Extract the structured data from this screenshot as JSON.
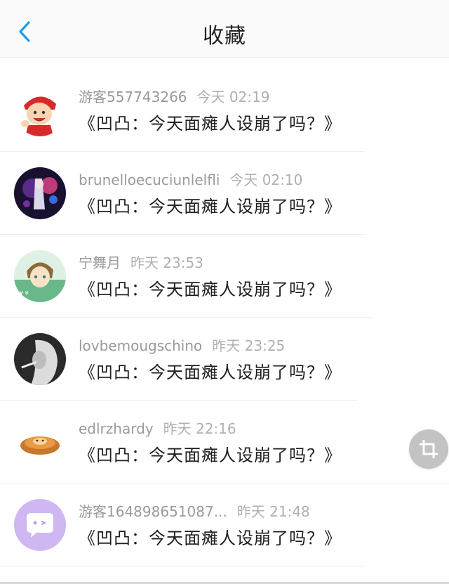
{
  "header": {
    "title": "收藏",
    "back_icon": "chevron-left-icon",
    "accent": "#1a9bf0"
  },
  "items": [
    {
      "user": "游客557743266",
      "time": "今天 02:19",
      "content": "《凹凸：今天面瘫人设崩了吗？》",
      "avatar": "cartoon-boy-avatar"
    },
    {
      "user": "brunelloecuciunlelfli",
      "time": "今天 02:10",
      "content": "《凹凸：今天面瘫人设崩了吗？》",
      "avatar": "anime-character-avatar"
    },
    {
      "user": "宁舞月",
      "time": "昨天 23:53",
      "content": "《凹凸：今天面瘫人设崩了吗？》",
      "avatar": "anime-boy-avatar"
    },
    {
      "user": "lovbemougschino",
      "time": "昨天 23:25",
      "content": "《凹凸：今天面瘫人设崩了吗？》",
      "avatar": "bw-portrait-avatar"
    },
    {
      "user": "edlrzhardy",
      "time": "昨天 22:16",
      "content": "《凹凸：今天面瘫人设崩了吗？》",
      "avatar": "food-avatar"
    },
    {
      "user": "游客164898651087...",
      "time": "昨天 21:48",
      "content": "《凹凸：今天面瘫人设崩了吗？》",
      "avatar": "default-chat-avatar"
    }
  ],
  "floating_button_icon": "crop-icon"
}
